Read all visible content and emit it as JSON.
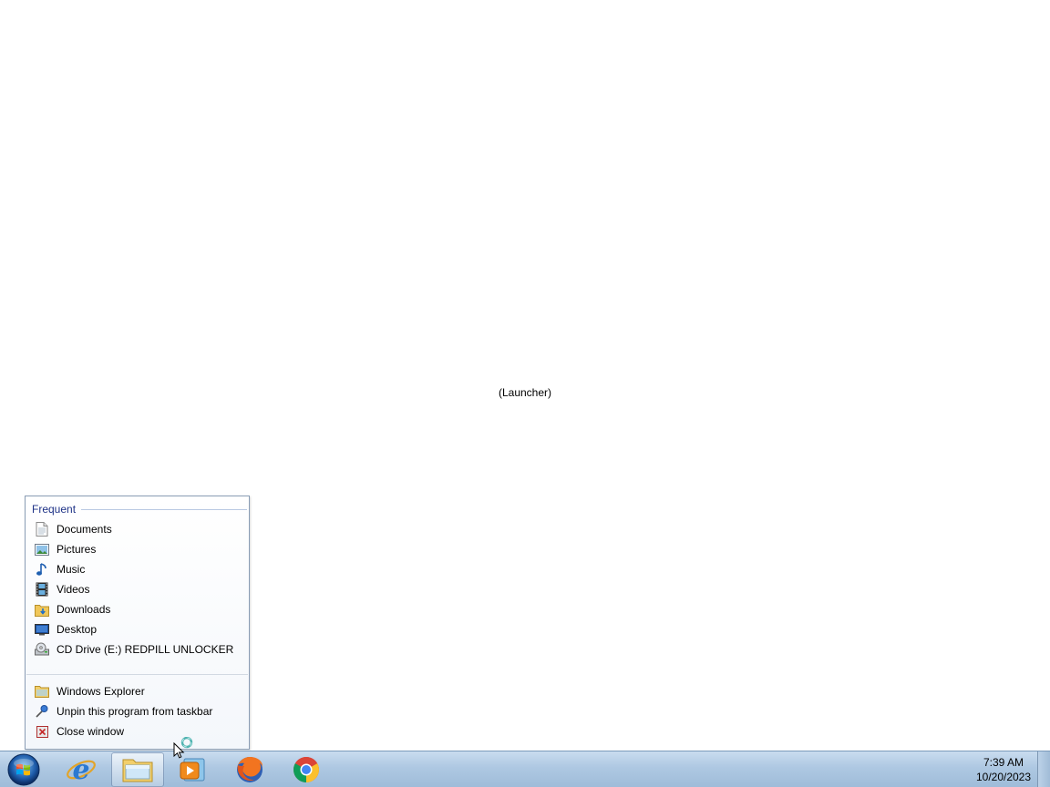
{
  "desktop": {
    "launcher_label": "(Launcher)"
  },
  "jumplist": {
    "section_title": "Frequent",
    "frequent": [
      {
        "label": "Documents",
        "icon": "document-icon"
      },
      {
        "label": "Pictures",
        "icon": "pictures-icon"
      },
      {
        "label": "Music",
        "icon": "music-icon"
      },
      {
        "label": "Videos",
        "icon": "videos-icon"
      },
      {
        "label": "Downloads",
        "icon": "downloads-folder-icon"
      },
      {
        "label": "Desktop",
        "icon": "desktop-icon"
      },
      {
        "label": "CD Drive (E:) REDPILL UNLOCKER",
        "icon": "cd-drive-icon"
      }
    ],
    "tasks": [
      {
        "label": "Windows Explorer",
        "icon": "folder-icon"
      },
      {
        "label": "Unpin this program from taskbar",
        "icon": "unpin-icon"
      },
      {
        "label": "Close window",
        "icon": "close-icon"
      }
    ]
  },
  "taskbar": {
    "start_icon": "windows-start-orb",
    "apps": [
      {
        "name": "Internet Explorer",
        "icon": "internet-explorer-icon",
        "active": false
      },
      {
        "name": "Windows Explorer",
        "icon": "windows-explorer-icon",
        "active": true
      },
      {
        "name": "Windows Media Player",
        "icon": "media-player-icon",
        "active": false
      },
      {
        "name": "Firefox",
        "icon": "firefox-icon",
        "active": false
      },
      {
        "name": "Chrome",
        "icon": "chrome-icon",
        "active": false
      }
    ],
    "clock": {
      "time": "7:39 AM",
      "date": "10/20/2023"
    }
  },
  "colors": {
    "section_header": "#1e3287",
    "taskbar": "#aec8e2",
    "jumplist_border": "#8a9db5"
  }
}
